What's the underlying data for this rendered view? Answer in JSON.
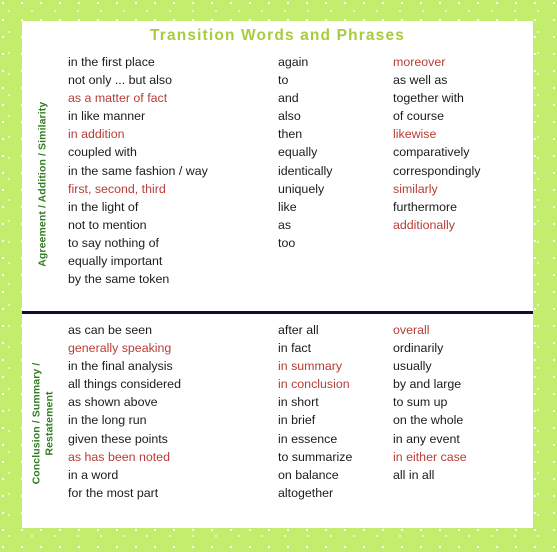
{
  "page": {
    "title": "Transition Words and Phrases",
    "accent_green": "#a9cb3c",
    "frame_green": "#c3ee6d",
    "label_green": "#2f7d1f",
    "highlight_red": "#b93d36",
    "divider_color": "#140a32"
  },
  "sections": [
    {
      "id": "agreement",
      "label": "Agreement / Addition / Similarity",
      "label_lines": [
        "Agreement / Addition / Similarity"
      ],
      "columns": [
        {
          "id": "agreement-col-1",
          "items": [
            {
              "text": "in the first place",
              "highlight": false
            },
            {
              "text": "not only ... but also",
              "highlight": false
            },
            {
              "text": "as a matter of fact",
              "highlight": true
            },
            {
              "text": "in like manner",
              "highlight": false
            },
            {
              "text": "in addition",
              "highlight": true
            },
            {
              "text": "coupled with",
              "highlight": false
            },
            {
              "text": "in the same fashion / way",
              "highlight": false
            },
            {
              "text": "first, second, third",
              "highlight": true
            },
            {
              "text": "in the light of",
              "highlight": false
            },
            {
              "text": "not to mention",
              "highlight": false
            },
            {
              "text": "to say nothing of",
              "highlight": false
            },
            {
              "text": "equally important",
              "highlight": false
            },
            {
              "text": "by the same token",
              "highlight": false
            }
          ]
        },
        {
          "id": "agreement-col-2",
          "items": [
            {
              "text": "again",
              "highlight": false
            },
            {
              "text": "to",
              "highlight": false
            },
            {
              "text": "and",
              "highlight": false
            },
            {
              "text": "also",
              "highlight": false
            },
            {
              "text": "then",
              "highlight": false
            },
            {
              "text": "equally",
              "highlight": false
            },
            {
              "text": "identically",
              "highlight": false
            },
            {
              "text": "uniquely",
              "highlight": false
            },
            {
              "text": "like",
              "highlight": false
            },
            {
              "text": "as",
              "highlight": false
            },
            {
              "text": "too",
              "highlight": false
            }
          ]
        },
        {
          "id": "agreement-col-3",
          "items": [
            {
              "text": "moreover",
              "highlight": true
            },
            {
              "text": "as well as",
              "highlight": false
            },
            {
              "text": "together with",
              "highlight": false
            },
            {
              "text": "of course",
              "highlight": false
            },
            {
              "text": "likewise",
              "highlight": true
            },
            {
              "text": "comparatively",
              "highlight": false
            },
            {
              "text": "correspondingly",
              "highlight": false
            },
            {
              "text": "similarly",
              "highlight": true
            },
            {
              "text": "furthermore",
              "highlight": false
            },
            {
              "text": "additionally",
              "highlight": true
            }
          ]
        }
      ]
    },
    {
      "id": "conclusion",
      "label": "Conclusion / Summary / Restatement",
      "label_lines": [
        "Conclusion / Summary /",
        "Restatement"
      ],
      "columns": [
        {
          "id": "conclusion-col-1",
          "items": [
            {
              "text": "as can be seen",
              "highlight": false
            },
            {
              "text": "generally speaking",
              "highlight": true
            },
            {
              "text": "in the final analysis",
              "highlight": false
            },
            {
              "text": "all things considered",
              "highlight": false
            },
            {
              "text": "as shown above",
              "highlight": false
            },
            {
              "text": "in the long run",
              "highlight": false
            },
            {
              "text": "given these points",
              "highlight": false
            },
            {
              "text": "as has been noted",
              "highlight": true
            },
            {
              "text": "in a word",
              "highlight": false
            },
            {
              "text": "for the most part",
              "highlight": false
            }
          ]
        },
        {
          "id": "conclusion-col-2",
          "items": [
            {
              "text": "after all",
              "highlight": false
            },
            {
              "text": "in fact",
              "highlight": false
            },
            {
              "text": "in summary",
              "highlight": true
            },
            {
              "text": "in conclusion",
              "highlight": true
            },
            {
              "text": "in short",
              "highlight": false
            },
            {
              "text": "in brief",
              "highlight": false
            },
            {
              "text": "in essence",
              "highlight": false
            },
            {
              "text": "to summarize",
              "highlight": false
            },
            {
              "text": "on balance",
              "highlight": false
            },
            {
              "text": "altogether",
              "highlight": false
            }
          ]
        },
        {
          "id": "conclusion-col-3",
          "items": [
            {
              "text": "overall",
              "highlight": true
            },
            {
              "text": "ordinarily",
              "highlight": false
            },
            {
              "text": "usually",
              "highlight": false
            },
            {
              "text": "by and large",
              "highlight": false
            },
            {
              "text": "to sum up",
              "highlight": false
            },
            {
              "text": "on the whole",
              "highlight": false
            },
            {
              "text": "in any event",
              "highlight": false
            },
            {
              "text": "in either case",
              "highlight": true
            },
            {
              "text": "all in all",
              "highlight": false
            }
          ]
        }
      ]
    }
  ]
}
